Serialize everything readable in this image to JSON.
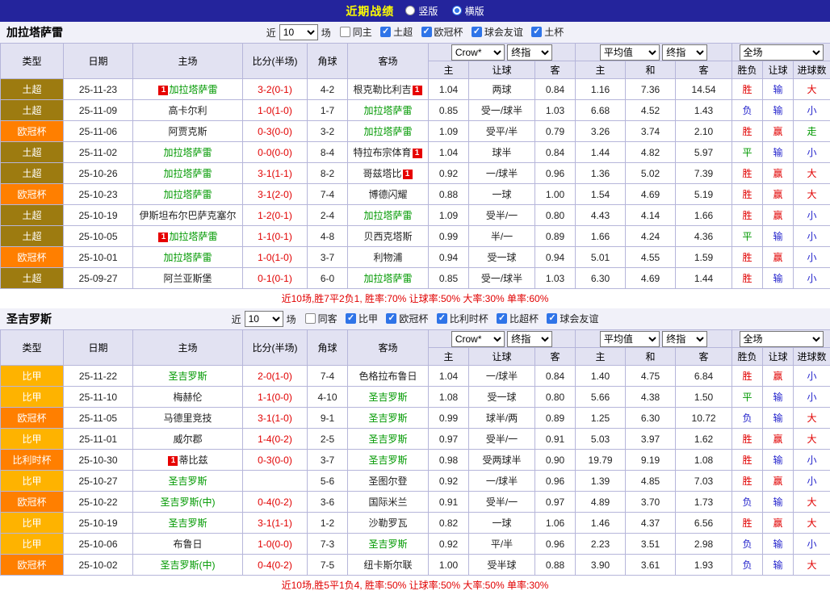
{
  "colors": {
    "topbar_bg": "#24249c",
    "title_yellow": "#ffff00",
    "accent_blue": "#2f74e8",
    "score_red": "#e10000",
    "self_team_green": "#009900"
  },
  "league_colors": {
    "土超": "#9d7b10",
    "欧冠杯": "#ff7f00",
    "比甲": "#feb300",
    "比利时杯": "#ff7f00"
  },
  "result_colors": {
    "胜": "#e10000",
    "赢": "#e10000",
    "大": "#e10000",
    "负": "#2424cc",
    "输": "#2424cc",
    "小": "#2424cc",
    "平": "#009900",
    "走": "#009900"
  },
  "topbar": {
    "title": "近期战绩",
    "options": [
      {
        "label": "竖版",
        "selected": false
      },
      {
        "label": "横版",
        "selected": true
      }
    ]
  },
  "table_header": {
    "type": "类型",
    "date": "日期",
    "home": "主场",
    "score": "比分(半场)",
    "corner": "角球",
    "away": "客场",
    "sel_crow": "Crow*",
    "sel_final1": "终指",
    "sel_avg": "平均值",
    "sel_final2": "终指",
    "sel_full": "全场",
    "h": "主",
    "handicap": "让球",
    "a": "客",
    "avg_h": "主",
    "avg_d": "和",
    "avg_a": "客",
    "wdl": "胜负",
    "handicap2": "让球",
    "goals": "进球数"
  },
  "sections": [
    {
      "team": "加拉塔萨雷",
      "filter": {
        "near": "近",
        "count": "10",
        "games": "场",
        "checkboxes": [
          {
            "label": "同主",
            "checked": false
          },
          {
            "label": "土超",
            "checked": true
          },
          {
            "label": "欧冠杯",
            "checked": true
          },
          {
            "label": "球会友谊",
            "checked": true
          },
          {
            "label": "土杯",
            "checked": true
          }
        ]
      },
      "rows": [
        {
          "type": "土超",
          "date": "25-11-23",
          "home": "加拉塔萨雷",
          "h_self": true,
          "h_pre": true,
          "score": "3-2(0-1)",
          "corner": "4-2",
          "away": "根克勒比利吉",
          "a_post": true,
          "o": [
            "1.04",
            "两球",
            "0.84",
            "1.16",
            "7.36",
            "14.54"
          ],
          "res": [
            "胜",
            "输",
            "大"
          ]
        },
        {
          "type": "土超",
          "date": "25-11-09",
          "home": "高卡尔利",
          "score": "1-0(1-0)",
          "corner": "1-7",
          "away": "加拉塔萨雷",
          "a_self": true,
          "o": [
            "0.85",
            "受一/球半",
            "1.03",
            "6.68",
            "4.52",
            "1.43"
          ],
          "res": [
            "负",
            "输",
            "小"
          ]
        },
        {
          "type": "欧冠杯",
          "date": "25-11-06",
          "home": "阿贾克斯",
          "score": "0-3(0-0)",
          "corner": "3-2",
          "away": "加拉塔萨雷",
          "a_self": true,
          "o": [
            "1.09",
            "受平/半",
            "0.79",
            "3.26",
            "3.74",
            "2.10"
          ],
          "res": [
            "胜",
            "赢",
            "走"
          ]
        },
        {
          "type": "土超",
          "date": "25-11-02",
          "home": "加拉塔萨雷",
          "h_self": true,
          "score": "0-0(0-0)",
          "corner": "8-4",
          "away": "特拉布宗体育",
          "a_post": true,
          "o": [
            "1.04",
            "球半",
            "0.84",
            "1.44",
            "4.82",
            "5.97"
          ],
          "res": [
            "平",
            "输",
            "小"
          ]
        },
        {
          "type": "土超",
          "date": "25-10-26",
          "home": "加拉塔萨雷",
          "h_self": true,
          "score": "3-1(1-1)",
          "corner": "8-2",
          "away": "哥兹塔比",
          "a_post": true,
          "o": [
            "0.92",
            "一/球半",
            "0.96",
            "1.36",
            "5.02",
            "7.39"
          ],
          "res": [
            "胜",
            "赢",
            "大"
          ]
        },
        {
          "type": "欧冠杯",
          "date": "25-10-23",
          "home": "加拉塔萨雷",
          "h_self": true,
          "score": "3-1(2-0)",
          "corner": "7-4",
          "away": "博德闪耀",
          "o": [
            "0.88",
            "一球",
            "1.00",
            "1.54",
            "4.69",
            "5.19"
          ],
          "res": [
            "胜",
            "赢",
            "大"
          ]
        },
        {
          "type": "土超",
          "date": "25-10-19",
          "home": "伊斯坦布尔巴萨克塞尔",
          "score": "1-2(0-1)",
          "corner": "2-4",
          "away": "加拉塔萨雷",
          "a_self": true,
          "o": [
            "1.09",
            "受半/一",
            "0.80",
            "4.43",
            "4.14",
            "1.66"
          ],
          "res": [
            "胜",
            "赢",
            "小"
          ]
        },
        {
          "type": "土超",
          "date": "25-10-05",
          "home": "加拉塔萨雷",
          "h_self": true,
          "h_pre": true,
          "score": "1-1(0-1)",
          "corner": "4-8",
          "away": "贝西克塔斯",
          "o": [
            "0.99",
            "半/一",
            "0.89",
            "1.66",
            "4.24",
            "4.36"
          ],
          "res": [
            "平",
            "输",
            "小"
          ]
        },
        {
          "type": "欧冠杯",
          "date": "25-10-01",
          "home": "加拉塔萨雷",
          "h_self": true,
          "score": "1-0(1-0)",
          "corner": "3-7",
          "away": "利物浦",
          "o": [
            "0.94",
            "受一球",
            "0.94",
            "5.01",
            "4.55",
            "1.59"
          ],
          "res": [
            "胜",
            "赢",
            "小"
          ]
        },
        {
          "type": "土超",
          "date": "25-09-27",
          "home": "阿兰亚斯堡",
          "score": "0-1(0-1)",
          "corner": "6-0",
          "away": "加拉塔萨雷",
          "a_self": true,
          "o": [
            "0.85",
            "受一/球半",
            "1.03",
            "6.30",
            "4.69",
            "1.44"
          ],
          "res": [
            "胜",
            "输",
            "小"
          ]
        }
      ],
      "summary": "近10场,胜7平2负1, 胜率:70% 让球率:50% 大率:30% 单率:60%"
    },
    {
      "team": "圣吉罗斯",
      "filter": {
        "near": "近",
        "count": "10",
        "games": "场",
        "checkboxes": [
          {
            "label": "同客",
            "checked": false
          },
          {
            "label": "比甲",
            "checked": true
          },
          {
            "label": "欧冠杯",
            "checked": true
          },
          {
            "label": "比利时杯",
            "checked": true
          },
          {
            "label": "比超杯",
            "checked": true
          },
          {
            "label": "球会友谊",
            "checked": true
          }
        ]
      },
      "rows": [
        {
          "type": "比甲",
          "date": "25-11-22",
          "home": "圣吉罗斯",
          "h_self": true,
          "score": "2-0(1-0)",
          "corner": "7-4",
          "away": "色格拉布鲁日",
          "o": [
            "1.04",
            "一/球半",
            "0.84",
            "1.40",
            "4.75",
            "6.84"
          ],
          "res": [
            "胜",
            "赢",
            "小"
          ]
        },
        {
          "type": "比甲",
          "date": "25-11-10",
          "home": "梅赫伦",
          "score": "1-1(0-0)",
          "corner": "4-10",
          "away": "圣吉罗斯",
          "a_self": true,
          "o": [
            "1.08",
            "受一球",
            "0.80",
            "5.66",
            "4.38",
            "1.50"
          ],
          "res": [
            "平",
            "输",
            "小"
          ]
        },
        {
          "type": "欧冠杯",
          "date": "25-11-05",
          "home": "马德里竞技",
          "score": "3-1(1-0)",
          "corner": "9-1",
          "away": "圣吉罗斯",
          "a_self": true,
          "o": [
            "0.99",
            "球半/两",
            "0.89",
            "1.25",
            "6.30",
            "10.72"
          ],
          "res": [
            "负",
            "输",
            "大"
          ]
        },
        {
          "type": "比甲",
          "date": "25-11-01",
          "home": "威尔郡",
          "score": "1-4(0-2)",
          "corner": "2-5",
          "away": "圣吉罗斯",
          "a_self": true,
          "o": [
            "0.97",
            "受半/一",
            "0.91",
            "5.03",
            "3.97",
            "1.62"
          ],
          "res": [
            "胜",
            "赢",
            "大"
          ]
        },
        {
          "type": "比利时杯",
          "date": "25-10-30",
          "home": "蒂比兹",
          "h_pre": true,
          "score": "0-3(0-0)",
          "corner": "3-7",
          "away": "圣吉罗斯",
          "a_self": true,
          "o": [
            "0.98",
            "受两球半",
            "0.90",
            "19.79",
            "9.19",
            "1.08"
          ],
          "res": [
            "胜",
            "输",
            "小"
          ]
        },
        {
          "type": "比甲",
          "date": "25-10-27",
          "home": "圣吉罗斯",
          "h_self": true,
          "score": "",
          "corner": "5-6",
          "away": "圣图尔登",
          "o": [
            "0.92",
            "一/球半",
            "0.96",
            "1.39",
            "4.85",
            "7.03"
          ],
          "res": [
            "胜",
            "赢",
            "小"
          ]
        },
        {
          "type": "欧冠杯",
          "date": "25-10-22",
          "home": "圣吉罗斯(中)",
          "h_self": true,
          "score": "0-4(0-2)",
          "corner": "3-6",
          "away": "国际米兰",
          "o": [
            "0.91",
            "受半/一",
            "0.97",
            "4.89",
            "3.70",
            "1.73"
          ],
          "res": [
            "负",
            "输",
            "大"
          ]
        },
        {
          "type": "比甲",
          "date": "25-10-19",
          "home": "圣吉罗斯",
          "h_self": true,
          "score": "3-1(1-1)",
          "corner": "1-2",
          "away": "沙勒罗瓦",
          "o": [
            "0.82",
            "一球",
            "1.06",
            "1.46",
            "4.37",
            "6.56"
          ],
          "res": [
            "胜",
            "赢",
            "大"
          ]
        },
        {
          "type": "比甲",
          "date": "25-10-06",
          "home": "布鲁日",
          "score": "1-0(0-0)",
          "corner": "7-3",
          "away": "圣吉罗斯",
          "a_self": true,
          "o": [
            "0.92",
            "平/半",
            "0.96",
            "2.23",
            "3.51",
            "2.98"
          ],
          "res": [
            "负",
            "输",
            "小"
          ]
        },
        {
          "type": "欧冠杯",
          "date": "25-10-02",
          "home": "圣吉罗斯(中)",
          "h_self": true,
          "score": "0-4(0-2)",
          "corner": "7-5",
          "away": "纽卡斯尔联",
          "o": [
            "1.00",
            "受半球",
            "0.88",
            "3.90",
            "3.61",
            "1.93"
          ],
          "res": [
            "负",
            "输",
            "大"
          ]
        }
      ],
      "summary": "近10场,胜5平1负4, 胜率:50% 让球率:50% 大率:50% 单率:30%"
    }
  ]
}
